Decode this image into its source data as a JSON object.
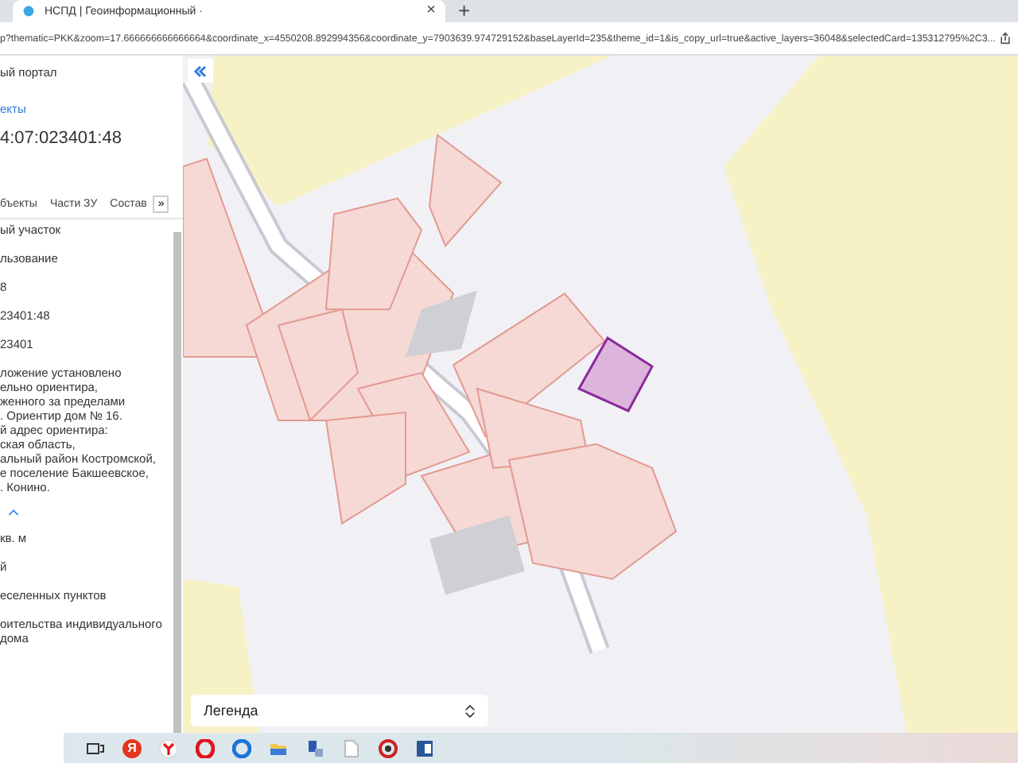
{
  "browser": {
    "tab_title": "НСПД | Геоинформационный ·",
    "tab_close": "×",
    "new_tab": "+",
    "address": "p?thematic=PKK&zoom=17.666666666666664&coordinate_x=4550208.892994356&coordinate_y=7903639.974729152&baseLayerId=235&theme_id=1&is_copy_url=true&active_layers=36048&selectedCard=135312795%2C3..."
  },
  "panel": {
    "portal": "ый портал",
    "link": "екты",
    "cadastral_number": "4:07:023401:48",
    "tabs": [
      "бъекты",
      "Части ЗУ",
      "Состав"
    ],
    "more": "»",
    "rows": [
      {
        "kind": "line",
        "text": "ый участок"
      },
      {
        "kind": "line",
        "text": "льзование"
      },
      {
        "kind": "line",
        "text": "8"
      },
      {
        "kind": "line",
        "text": "23401:48"
      },
      {
        "kind": "line",
        "text": "23401"
      },
      {
        "kind": "paragraph",
        "lines": [
          "ложение установлено",
          "ельно ориентира,",
          "женного за пределами",
          ". Ориентир дом № 16.",
          "й адрес ориентира:",
          "ская область,",
          "альный район Костромской,",
          "е поселение Бакшеевское,",
          ". Конино."
        ]
      },
      {
        "kind": "collapse"
      },
      {
        "kind": "line",
        "text": "кв. м"
      },
      {
        "kind": "line",
        "text": "й"
      },
      {
        "kind": "line",
        "text": "еселенных пунктов"
      },
      {
        "kind": "paragraph",
        "lines": [
          "оительства индивидуального",
          "дома"
        ]
      }
    ]
  },
  "map": {
    "kind": "picture",
    "legend": "Легенда"
  },
  "taskbar": {
    "yandex": "Я"
  }
}
